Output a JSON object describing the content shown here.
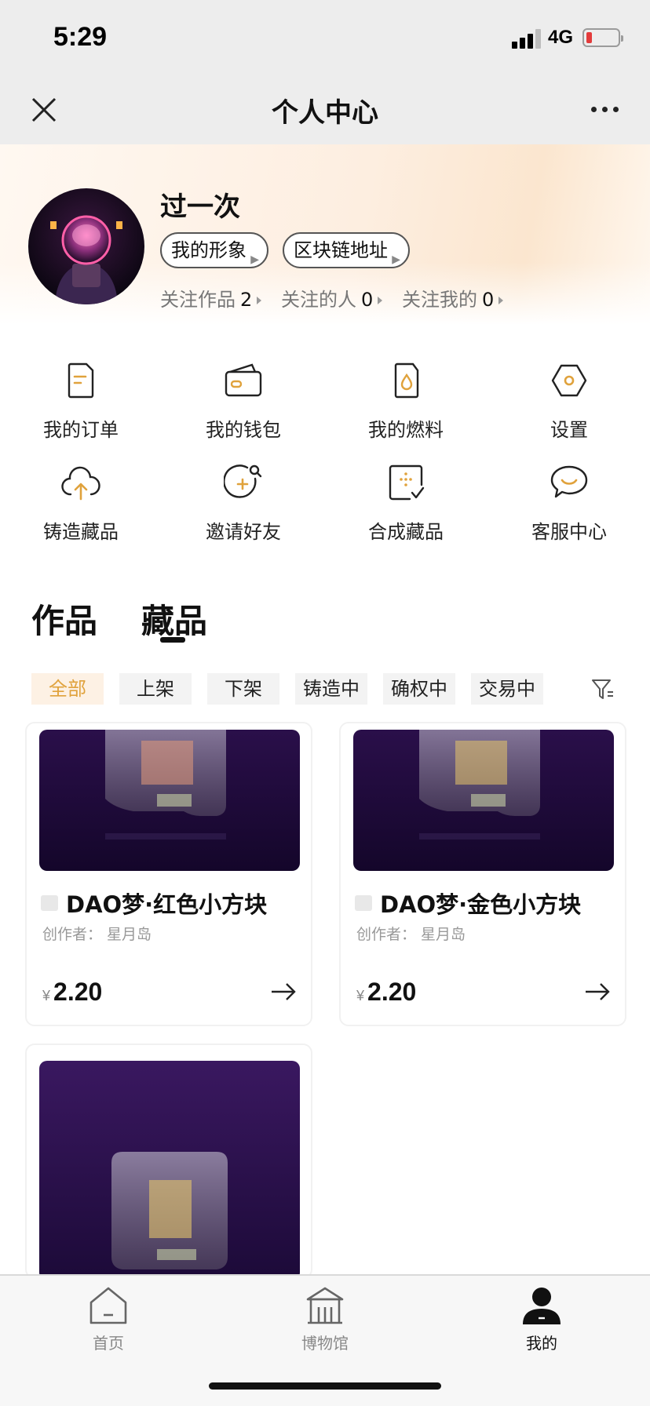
{
  "status_bar": {
    "time": "5:29",
    "network": "4G",
    "battery_level": 0.15,
    "battery_color": "#e33b3b"
  },
  "nav": {
    "title": "个人中心",
    "close_icon": "close-icon",
    "more_icon": "more-icon"
  },
  "profile": {
    "username": "过一次",
    "chips": [
      {
        "label": "我的形象"
      },
      {
        "label": "区块链地址"
      }
    ],
    "follows": [
      {
        "label": "关注作品",
        "count": "2"
      },
      {
        "label": "关注的人",
        "count": "0"
      },
      {
        "label": "关注我的",
        "count": "0"
      }
    ]
  },
  "menu": [
    {
      "label": "我的订单",
      "icon": "order-icon"
    },
    {
      "label": "我的钱包",
      "icon": "wallet-icon"
    },
    {
      "label": "我的燃料",
      "icon": "fuel-icon"
    },
    {
      "label": "设置",
      "icon": "settings-icon"
    },
    {
      "label": "铸造藏品",
      "icon": "mint-icon"
    },
    {
      "label": "邀请好友",
      "icon": "invite-icon"
    },
    {
      "label": "合成藏品",
      "icon": "compose-icon"
    },
    {
      "label": "客服中心",
      "icon": "service-icon"
    }
  ],
  "tabs": {
    "items": [
      {
        "label": "作品"
      },
      {
        "label": "藏品"
      }
    ],
    "active": "藏品"
  },
  "filters": {
    "items": [
      {
        "label": "全部"
      },
      {
        "label": "上架"
      },
      {
        "label": "下架"
      },
      {
        "label": "铸造中"
      },
      {
        "label": "确权中"
      },
      {
        "label": "交易中"
      }
    ],
    "active": "全部"
  },
  "cards": [
    {
      "title": "DAO梦·红色小方块",
      "creator": "创作者：  星月岛",
      "currency": "¥",
      "price": "2.20"
    },
    {
      "title": "DAO梦·金色小方块",
      "creator": "创作者：  星月岛",
      "currency": "¥",
      "price": "2.20"
    },
    {
      "title": "",
      "creator": "",
      "currency": "",
      "price": ""
    }
  ],
  "tabbar": {
    "items": [
      {
        "label": "首页",
        "icon": "home-icon"
      },
      {
        "label": "博物馆",
        "icon": "museum-icon"
      },
      {
        "label": "我的",
        "icon": "profile-icon"
      }
    ],
    "active": "我的"
  },
  "colors": {
    "accent": "#e0a23c",
    "active_filter_bg": "#fdf1e4"
  }
}
